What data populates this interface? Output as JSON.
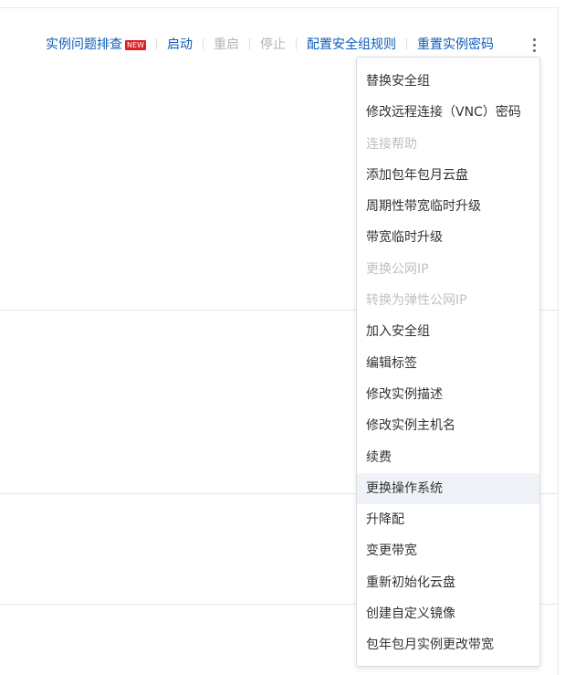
{
  "toolbar": {
    "troubleshoot": "实例问题排查",
    "new_badge": "NEW",
    "start": "启动",
    "restart": "重启",
    "stop": "停止",
    "config_security_rules": "配置安全组规则",
    "reset_password": "重置实例密码"
  },
  "menu": {
    "items": [
      {
        "label": "替换安全组",
        "disabled": false
      },
      {
        "label": "修改远程连接（VNC）密码",
        "disabled": false
      },
      {
        "label": "连接帮助",
        "disabled": true
      },
      {
        "label": "添加包年包月云盘",
        "disabled": false
      },
      {
        "label": "周期性带宽临时升级",
        "disabled": false
      },
      {
        "label": "带宽临时升级",
        "disabled": false
      },
      {
        "label": "更换公网IP",
        "disabled": true
      },
      {
        "label": "转换为弹性公网IP",
        "disabled": true
      },
      {
        "label": "加入安全组",
        "disabled": false
      },
      {
        "label": "编辑标签",
        "disabled": false
      },
      {
        "label": "修改实例描述",
        "disabled": false
      },
      {
        "label": "修改实例主机名",
        "disabled": false
      },
      {
        "label": "续费",
        "disabled": false
      },
      {
        "label": "更换操作系统",
        "disabled": false,
        "hovered": true
      },
      {
        "label": "升降配",
        "disabled": false
      },
      {
        "label": "变更带宽",
        "disabled": false
      },
      {
        "label": "重新初始化云盘",
        "disabled": false
      },
      {
        "label": "创建自定义镜像",
        "disabled": false
      },
      {
        "label": "包年包月实例更改带宽",
        "disabled": false
      }
    ]
  },
  "colors": {
    "link": "#0f5db8",
    "disabled": "#b3b3b3",
    "menu_text": "#333333",
    "hover_bg": "#eff3f8",
    "badge": "#e02020"
  },
  "icons": {
    "more": "more-vertical-icon"
  }
}
